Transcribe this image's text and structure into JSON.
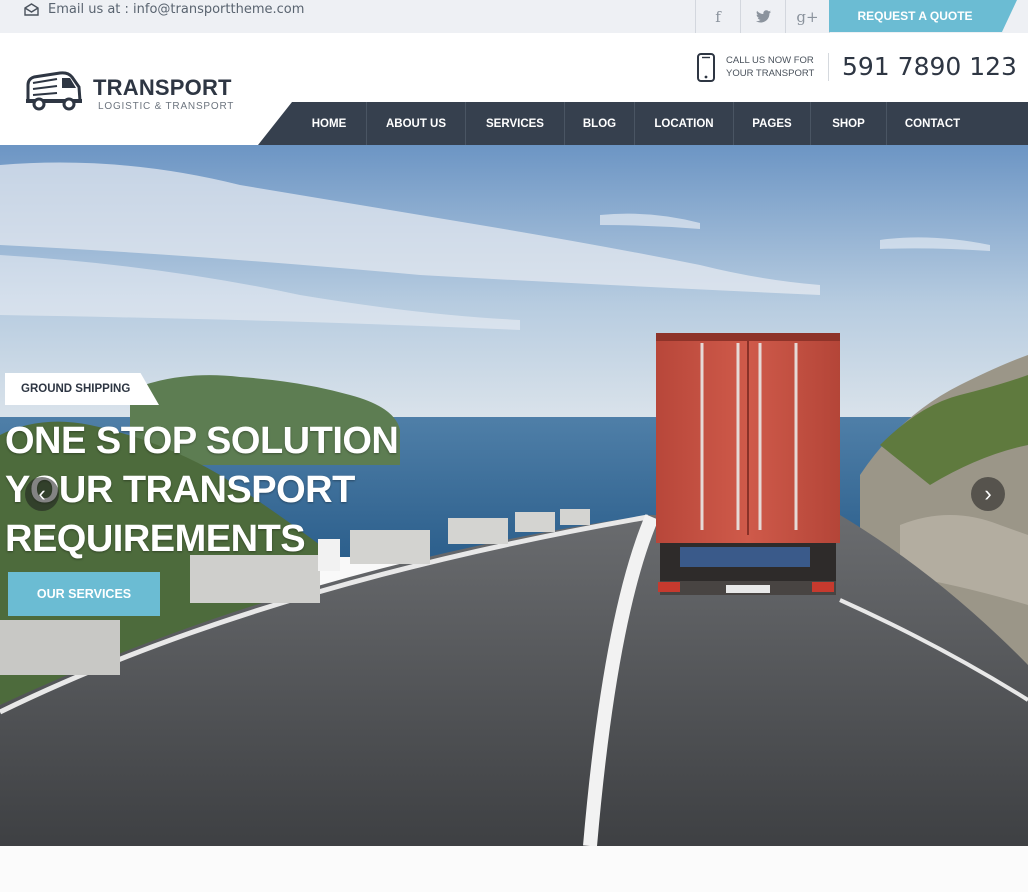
{
  "topbar": {
    "email_text": "Email us at : info@transporttheme.com",
    "social": [
      {
        "name": "facebook",
        "glyph": "f"
      },
      {
        "name": "twitter",
        "glyph": "t"
      },
      {
        "name": "google-plus",
        "glyph": "g+"
      }
    ],
    "quote_button": "REQUEST A QUOTE"
  },
  "brand": {
    "title": "TRANSPORT",
    "subtitle": "LOGISTIC & TRANSPORT"
  },
  "contact": {
    "call_line1": "CALL US NOW FOR",
    "call_line2": "YOUR TRANSPORT",
    "phone": "591 7890 123"
  },
  "nav": {
    "items": [
      "HOME",
      "ABOUT US",
      "SERVICES",
      "BLOG",
      "LOCATION",
      "PAGES",
      "SHOP",
      "CONTACT"
    ]
  },
  "hero": {
    "badge": "GROUND SHIPPING",
    "headline_line1": "ONE STOP SOLUTION",
    "headline_line2": "YOUR TRANSPORT",
    "headline_line3": "REQUIREMENTS",
    "button": "OUR SERVICES",
    "prev_glyph": "‹",
    "next_glyph": "›"
  },
  "colors": {
    "accent": "#6bbcd3",
    "nav_bg": "#36404e",
    "topbar_bg": "#eef0f4"
  }
}
